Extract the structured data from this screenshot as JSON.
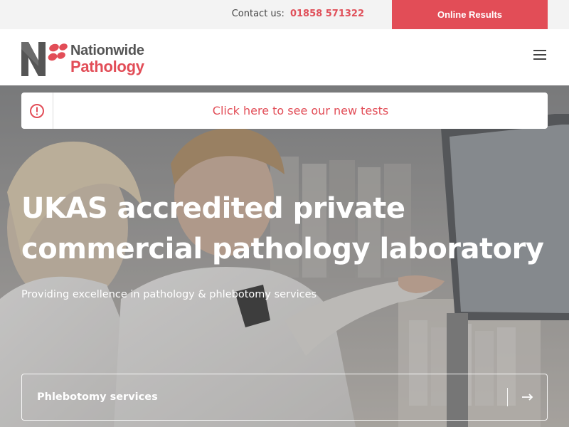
{
  "topbar": {
    "contact_label": "Contact us:",
    "phone": "01858 571322",
    "online_results_label": "Online Results"
  },
  "header": {
    "logo": {
      "line1": "Nationwide",
      "line2": "Pathology"
    },
    "menu_icon": "hamburger-icon"
  },
  "notice": {
    "icon": "alert-circle-icon",
    "text": "Click here to see our new tests"
  },
  "hero": {
    "title_line1": "UKAS accredited private",
    "title_line2": "commercial pathology laboratory",
    "subtitle": "Providing excellence in pathology & phlebotomy services",
    "service_label": "Phlebotomy services",
    "service_icon": "arrow-right-icon"
  },
  "colors": {
    "brand_red": "#e24d57",
    "brand_grey": "#555555",
    "topbar_bg": "#f3f3f3"
  }
}
